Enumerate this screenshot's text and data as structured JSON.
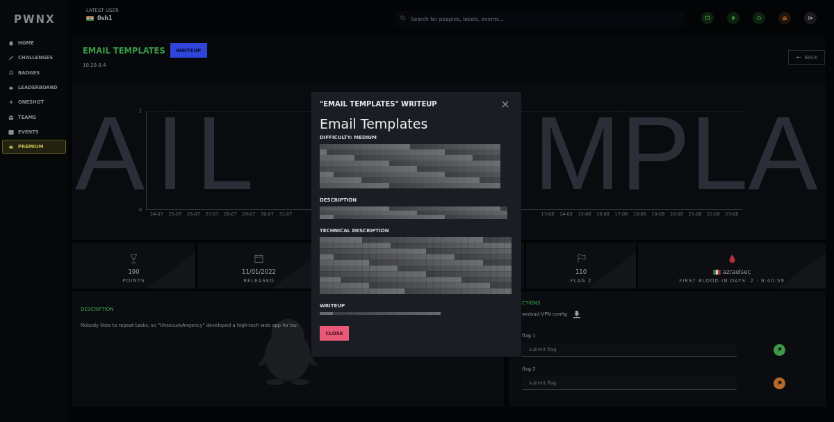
{
  "logo": "PWNX",
  "latest_user": {
    "label": "LATEST USER",
    "name": "0sh1"
  },
  "sidebar": {
    "items": [
      {
        "label": "HOME",
        "selected": false
      },
      {
        "label": "CHALLENGES",
        "selected": false
      },
      {
        "label": "BADGES",
        "selected": false
      },
      {
        "label": "LEADERBOARD",
        "selected": false
      },
      {
        "label": "ONESHOT",
        "selected": false
      },
      {
        "label": "TEAMS",
        "selected": false
      },
      {
        "label": "EVENTS",
        "selected": false
      },
      {
        "label": "PREMIUM",
        "selected": true
      }
    ]
  },
  "search": {
    "placeholder": "Search for peoples, labels, events..."
  },
  "header": {
    "title": "EMAIL TEMPLATES",
    "writeup_button": "WRITEUP",
    "address": "10.20.0.4",
    "back_button": "BACK"
  },
  "chart": {
    "watermark_left": "AIL",
    "watermark_right": "MPLA",
    "y_labels": [
      "1",
      "0"
    ],
    "x_labels_left": [
      "24-07",
      "25-07",
      "26-07",
      "27-07",
      "28-07",
      "29-07",
      "30-07",
      "31-07"
    ],
    "x_labels_right": [
      "13-08",
      "14-08",
      "15-08",
      "16-08",
      "17-08",
      "18-08",
      "19-08",
      "20-08",
      "21-08",
      "22-08",
      "23-08"
    ]
  },
  "stats": [
    {
      "kind": "trophy",
      "value": "190",
      "label": "POINTS"
    },
    {
      "kind": "calendar",
      "value": "11/01/2022",
      "label": "RELEASED"
    },
    {
      "kind": "hidden"
    },
    {
      "kind": "flag",
      "value": "110",
      "label": "FLAG 2"
    },
    {
      "kind": "blood",
      "value": "azraelsec",
      "label": "FIRST BLOOD IN DAYS: 2 - 9:40:59"
    }
  ],
  "description": {
    "title": "DESCRIPTION",
    "text": "Nobody likes to repeat tasks, so \"UnsecureAngency\" developed a high-tech web app for bui"
  },
  "actions": {
    "title": "CTIONS",
    "download": "wnload VPN config",
    "flags": [
      {
        "label": "flag 1",
        "placeholder": "submit flag",
        "color": "#3f9a48"
      },
      {
        "label": "flag 2",
        "placeholder": "submit flag",
        "color": "#b8692a"
      }
    ]
  },
  "modal": {
    "title": "\"EMAIL TEMPLATES\" WRITEUP",
    "heading": "Email Templates",
    "difficulty": "DIFFICULTY: MEDIUM",
    "sections": [
      "DESCRIPTION",
      "TECHNICAL DESCRIPTION",
      "WRITEUP"
    ],
    "close_button": "CLOSE"
  }
}
